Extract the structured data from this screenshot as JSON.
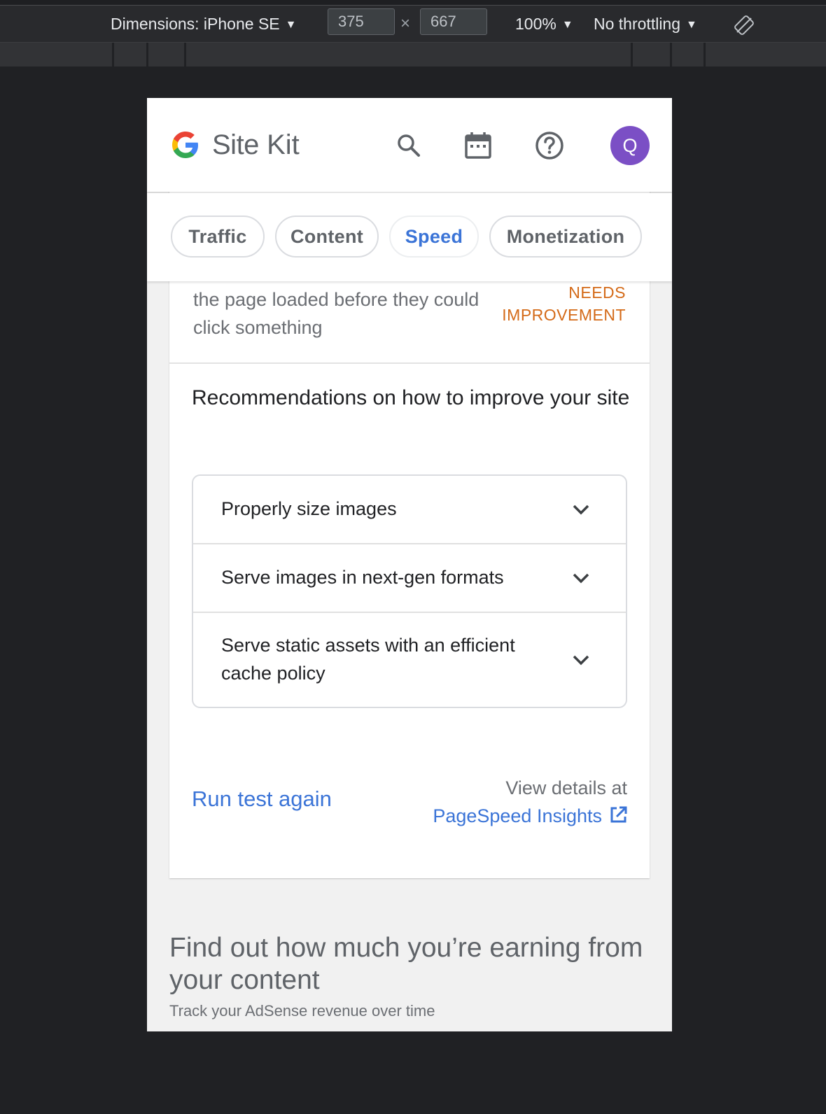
{
  "devtools": {
    "dimensions_label": "Dimensions: iPhone SE",
    "width_value": "375",
    "height_value": "667",
    "times": "×",
    "zoom": "100%",
    "throttling": "No throttling",
    "caret": "▼"
  },
  "header": {
    "brand_site": "Site",
    "brand_kit": "Kit",
    "avatar_initial": "Q",
    "icons": [
      "google-g-logo",
      "search-icon",
      "calendar-icon",
      "help-icon"
    ]
  },
  "tabs": [
    {
      "label": "Traffic",
      "active": false
    },
    {
      "label": "Content",
      "active": false
    },
    {
      "label": "Speed",
      "active": true
    },
    {
      "label": "Monetization",
      "active": false
    }
  ],
  "metric": {
    "description": "the page loaded before they could click something",
    "status_line1": "NEEDS",
    "status_line2": "IMPROVEMENT"
  },
  "recommendations": {
    "title": "Recommendations on how to improve your site",
    "items": [
      {
        "label": "Properly size images"
      },
      {
        "label": "Serve images in next-gen formats"
      },
      {
        "label": "Serve static assets with an efficient cache policy"
      }
    ]
  },
  "actions": {
    "run_again": "Run test again",
    "view_details": "View details at",
    "psi_link": "PageSpeed Insights"
  },
  "promo": {
    "title": "Find out how much you’re earning from your content",
    "subtitle": "Track your AdSense revenue over time"
  },
  "colors": {
    "accent": "#3b74d7",
    "warning": "#d46a18",
    "avatar": "#7b4fc5"
  }
}
